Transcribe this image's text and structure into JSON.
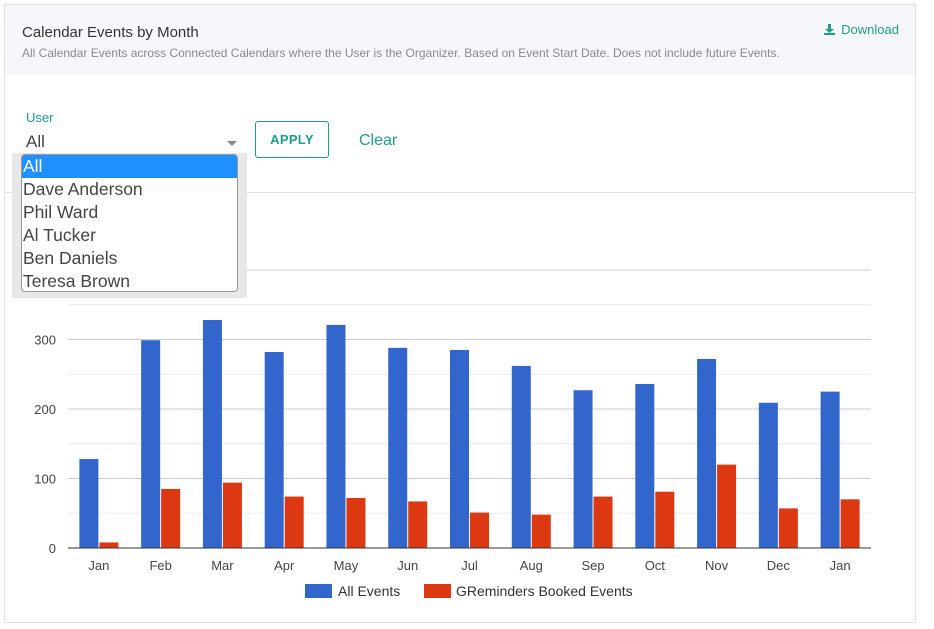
{
  "header": {
    "title": "Calendar Events by Month",
    "subtitle": "All Calendar Events across Connected Calendars where the User is the Organizer. Based on Event Start Date. Does not include future Events.",
    "download_label": "Download",
    "download_icon": "download-icon"
  },
  "filters": {
    "user_label": "User",
    "user_value": "All",
    "apply_label": "APPLY",
    "clear_label": "Clear",
    "user_options": [
      "All",
      "Dave Anderson",
      "Phil Ward",
      "Al Tucker",
      "Ben Daniels",
      "Teresa Brown"
    ]
  },
  "colors": {
    "accent": "#1e9e8a",
    "selected_option": "#1e90ff",
    "all_events": "#3366cc",
    "greminders": "#dc3912"
  },
  "chart_data": {
    "type": "bar",
    "categories": [
      "Jan",
      "Feb",
      "Mar",
      "Apr",
      "May",
      "Jun",
      "Jul",
      "Aug",
      "Sep",
      "Oct",
      "Nov",
      "Dec",
      "Jan"
    ],
    "series": [
      {
        "name": "All Events",
        "values": [
          128,
          299,
          328,
          282,
          321,
          288,
          285,
          262,
          227,
          236,
          272,
          209,
          225
        ]
      },
      {
        "name": "GReminders Booked Events",
        "values": [
          8,
          85,
          94,
          74,
          72,
          67,
          51,
          48,
          74,
          81,
          120,
          57,
          70
        ]
      }
    ],
    "title": "",
    "xlabel": "",
    "ylabel": "",
    "yticks": [
      "0",
      "100",
      "200",
      "300"
    ],
    "ylim": [
      0,
      400
    ],
    "grid": true,
    "legend_position": "bottom"
  }
}
